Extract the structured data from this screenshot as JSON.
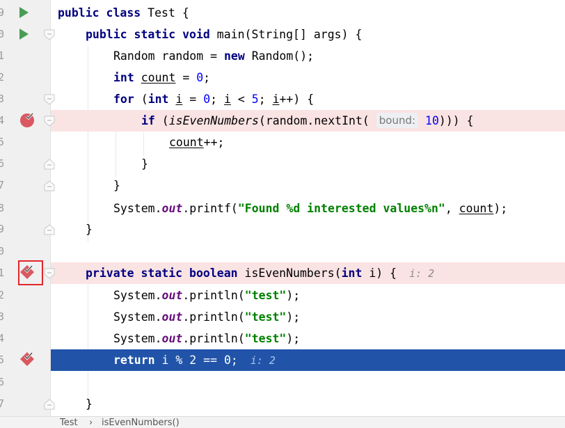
{
  "line_numbers": [
    "9",
    "0",
    "1",
    "2",
    "3",
    "4",
    "5",
    "6",
    "7",
    "8",
    "9",
    "0",
    "1",
    "2",
    "3",
    "4",
    "5",
    "6",
    "7"
  ],
  "code": {
    "l0": {
      "kw1": "public",
      "kw2": "class",
      "rest": " Test {"
    },
    "l1": {
      "kw1": "public",
      "kw2": "static",
      "kw3": "void",
      "rest": " main(String[] args) {"
    },
    "l2": {
      "t1": "Random random = ",
      "kw": "new",
      "t2": " Random();"
    },
    "l3": {
      "kw": "int",
      "var": "count",
      "t1": " = ",
      "num": "0",
      "t2": ";"
    },
    "l4": {
      "kw1": "for",
      "t1": " (",
      "kw2": "int",
      "v1": "i",
      "t2": " = ",
      "n1": "0",
      "t3": "; ",
      "v2": "i",
      "t4": " < ",
      "n2": "5",
      "t5": "; ",
      "v3": "i",
      "t6": "++) {"
    },
    "l5": {
      "kw": "if",
      "t1": " (",
      "call": "isEvenNumbers",
      "t2": "(random.nextInt( ",
      "hint": "bound:",
      "num": "10",
      "t3": "))) {"
    },
    "l6": {
      "var": "count",
      "t1": "++;"
    },
    "l7": {
      "t1": "}"
    },
    "l8": {
      "t1": "}"
    },
    "l9": {
      "t1": "System.",
      "fld": "out",
      "t2": ".printf(",
      "str": "\"Found %d interested values%n\"",
      "t3": ", ",
      "var": "count",
      "t4": ");"
    },
    "l10": {
      "t1": "}"
    },
    "l12": {
      "kw1": "private",
      "kw2": "static",
      "kw3": "boolean",
      "t1": " isEvenNumbers(",
      "kw4": "int",
      "t2": " i) {",
      "inlay": "i: 2"
    },
    "l13": {
      "t1": "System.",
      "fld": "out",
      "t2": ".println(",
      "str": "\"test\"",
      "t3": ");"
    },
    "l14": {
      "t1": "System.",
      "fld": "out",
      "t2": ".println(",
      "str": "\"test\"",
      "t3": ");"
    },
    "l15": {
      "t1": "System.",
      "fld": "out",
      "t2": ".println(",
      "str": "\"test\"",
      "t3": ");"
    },
    "l16": {
      "kw": "return",
      "t1": " i % 2 == 0;",
      "inlay": "i: 2"
    },
    "l18": {
      "t1": "}"
    }
  },
  "breadcrumbs": [
    "Test",
    "isEvenNumbers()"
  ],
  "colors": {
    "run": "#499c54",
    "breakpoint": "#db5860",
    "current_line": "#2154a8",
    "breakpoint_line": "#fae3e3"
  }
}
